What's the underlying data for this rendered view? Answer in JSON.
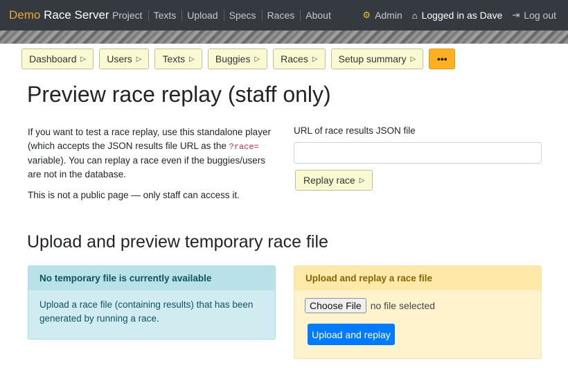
{
  "navbar": {
    "brand_demo": "Demo",
    "brand_rest": "Race Server",
    "links": [
      "Project",
      "Texts",
      "Upload",
      "Specs",
      "Races",
      "About"
    ],
    "admin": "Admin",
    "logged_in": "Logged in as Dave",
    "logout": "Log out"
  },
  "subnav": {
    "dashboard": "Dashboard",
    "users": "Users",
    "texts": "Texts",
    "buggies": "Buggies",
    "races": "Races",
    "setup": "Setup summary",
    "more": "•••"
  },
  "page_title": "Preview race replay (staff only)",
  "intro": {
    "p1_a": "If you want to test a race replay, use this standalone player (which accepts the JSON results file URL as the ",
    "p1_code": "?race=",
    "p1_b": " variable). You can replay a race even if the buggies/users are not in the database.",
    "p2": "This is not a public page — only staff can access it."
  },
  "form": {
    "label": "URL of race results JSON file",
    "value": "",
    "button": "Replay race"
  },
  "section_title": "Upload and preview temporary race file",
  "info_card": {
    "header": "No temporary file is currently available",
    "body": "Upload a race file (containing results) that has been generated by running a race."
  },
  "upload_card": {
    "header": "Upload and replay a race file",
    "choose": "Choose File",
    "no_file": "no file selected",
    "button": "Upload and replay"
  },
  "colors": {
    "navbar": "#343a40",
    "brand_accent": "#f0a830",
    "subnav_button": "#fafad2",
    "more_button": "#ffb020",
    "info": "#d1ecf1",
    "warning": "#fff3cd",
    "primary": "#007bff"
  },
  "icons": {
    "admin": "gear-icon",
    "user": "home-icon",
    "logout": "logout-icon",
    "nav_arrow": "triangle-right-icon"
  }
}
